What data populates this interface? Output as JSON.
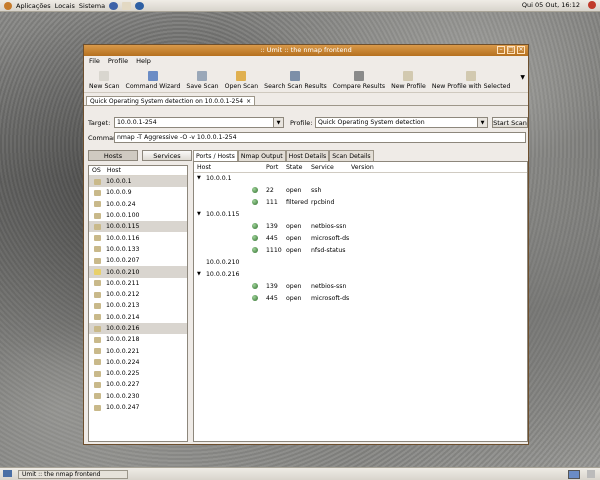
{
  "top_panel": {
    "menus": [
      "Aplicações",
      "Locais",
      "Sistema"
    ],
    "clock": "Qui 05 Out, 16:12"
  },
  "window": {
    "title": ":: Umit :: the nmap frontend",
    "menu": [
      "File",
      "Profile",
      "Help"
    ],
    "toolbar": [
      {
        "label": "New Scan",
        "icon": "new-scan-icon",
        "color": "#d9d6cf"
      },
      {
        "label": "Command Wizard",
        "icon": "wizard-icon",
        "color": "#6b8cc5"
      },
      {
        "label": "Save Scan",
        "icon": "save-icon",
        "color": "#9aa7b8"
      },
      {
        "label": "Open Scan",
        "icon": "folder-icon",
        "color": "#e0b050"
      },
      {
        "label": "Search Scan Results",
        "icon": "search-icon",
        "color": "#7d8fa8"
      },
      {
        "label": "Compare Results",
        "icon": "compare-icon",
        "color": "#8a8a8a"
      },
      {
        "label": "New Profile",
        "icon": "new-profile-icon",
        "color": "#d2c9b0"
      },
      {
        "label": "New Profile with Selected",
        "icon": "profile-selected-icon",
        "color": "#d2c9b0"
      }
    ],
    "scan_tab": "Quick Operating System detection on 10.0.0.1-254",
    "target_label": "Target:",
    "target_value": "10.0.0.1-254",
    "profile_label": "Profile:",
    "profile_value": "Quick Operating System detection",
    "start_scan": "Start Scan",
    "command_label": "Command:",
    "command_value": "nmap -T Aggressive -O -v 10.0.0.1-254"
  },
  "left_pane": {
    "hosts_button": "Hosts",
    "services_button": "Services",
    "col_os": "OS",
    "col_host": "Host",
    "hosts": [
      {
        "ip": "10.0.0.1",
        "hl": true,
        "os": "bsd"
      },
      {
        "ip": "10.0.0.9",
        "hl": false,
        "os": "bsd"
      },
      {
        "ip": "10.0.0.24",
        "hl": false,
        "os": "win"
      },
      {
        "ip": "10.0.0.100",
        "hl": false,
        "os": "win"
      },
      {
        "ip": "10.0.0.115",
        "hl": true,
        "os": "win"
      },
      {
        "ip": "10.0.0.116",
        "hl": false,
        "os": "win"
      },
      {
        "ip": "10.0.0.133",
        "hl": false,
        "os": "win"
      },
      {
        "ip": "10.0.0.207",
        "hl": false,
        "os": "win"
      },
      {
        "ip": "10.0.0.210",
        "hl": true,
        "os": "linux"
      },
      {
        "ip": "10.0.0.211",
        "hl": false,
        "os": "win"
      },
      {
        "ip": "10.0.0.212",
        "hl": false,
        "os": "win"
      },
      {
        "ip": "10.0.0.213",
        "hl": false,
        "os": "win"
      },
      {
        "ip": "10.0.0.214",
        "hl": false,
        "os": "win"
      },
      {
        "ip": "10.0.0.216",
        "hl": true,
        "os": "win"
      },
      {
        "ip": "10.0.0.218",
        "hl": false,
        "os": "win"
      },
      {
        "ip": "10.0.0.221",
        "hl": false,
        "os": "win"
      },
      {
        "ip": "10.0.0.224",
        "hl": false,
        "os": "win"
      },
      {
        "ip": "10.0.0.225",
        "hl": false,
        "os": "win"
      },
      {
        "ip": "10.0.0.227",
        "hl": false,
        "os": "win"
      },
      {
        "ip": "10.0.0.230",
        "hl": false,
        "os": "win"
      },
      {
        "ip": "10.0.0.247",
        "hl": false,
        "os": "win"
      }
    ]
  },
  "right_pane": {
    "tabs": [
      "Ports / Hosts",
      "Nmap Output",
      "Host Details",
      "Scan Details"
    ],
    "headers": {
      "host": "Host",
      "port": "Port",
      "state": "State",
      "service": "Service",
      "version": "Version"
    },
    "rows": [
      {
        "kind": "host",
        "host": "10.0.0.1",
        "expander": true
      },
      {
        "kind": "port",
        "port": "22",
        "state": "open",
        "service": "ssh"
      },
      {
        "kind": "port",
        "port": "111",
        "state": "filtered",
        "service": "rpcbind"
      },
      {
        "kind": "host",
        "host": "10.0.0.115",
        "expander": true
      },
      {
        "kind": "port",
        "port": "139",
        "state": "open",
        "service": "netbios-ssn"
      },
      {
        "kind": "port",
        "port": "445",
        "state": "open",
        "service": "microsoft-ds"
      },
      {
        "kind": "port",
        "port": "1110",
        "state": "open",
        "service": "nfsd-status"
      },
      {
        "kind": "host",
        "host": "10.0.0.210",
        "expander": false
      },
      {
        "kind": "host",
        "host": "10.0.0.216",
        "expander": true
      },
      {
        "kind": "port",
        "port": "139",
        "state": "open",
        "service": "netbios-ssn"
      },
      {
        "kind": "port",
        "port": "445",
        "state": "open",
        "service": "microsoft-ds"
      }
    ]
  },
  "taskbar": {
    "task": "Umit :: the nmap frontend"
  }
}
